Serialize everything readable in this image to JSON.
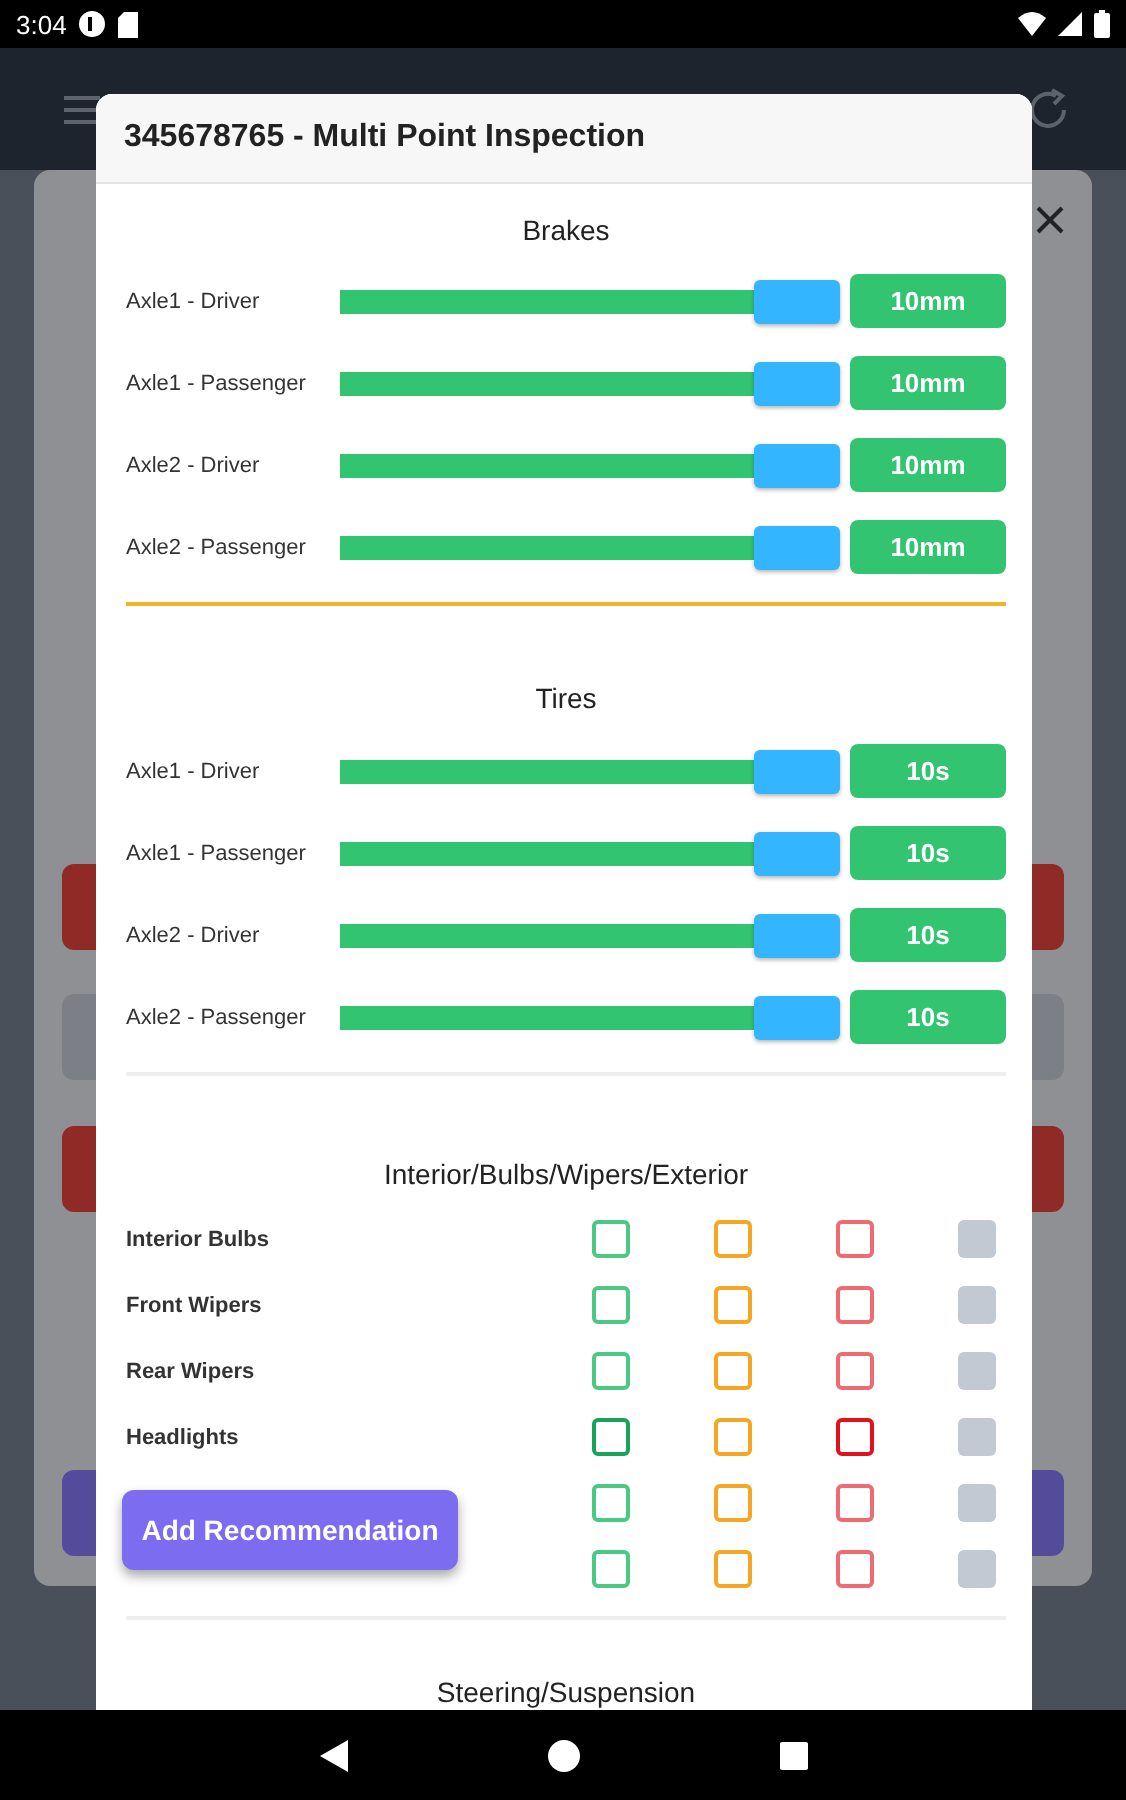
{
  "status_bar": {
    "time": "3:04"
  },
  "dialog": {
    "title": "345678765 - Multi Point Inspection",
    "sections": [
      {
        "kind": "slider",
        "title": "Brakes",
        "divider": {
          "color": "#f0b429"
        },
        "rows": [
          {
            "label": "Axle1 - Driver",
            "level": 1,
            "reading": "10mm"
          },
          {
            "label": "Axle1 - Passenger",
            "level": 1,
            "reading": "10mm"
          },
          {
            "label": "Axle2 - Driver",
            "level": 1,
            "reading": "10mm"
          },
          {
            "label": "Axle2 - Passenger",
            "level": 1,
            "reading": "10mm"
          }
        ]
      },
      {
        "kind": "slider",
        "title": "Tires",
        "divider": {
          "color": "#eeeeee"
        },
        "rows": [
          {
            "label": "Axle1 - Driver",
            "level": 1,
            "reading": "10s"
          },
          {
            "label": "Axle1 - Passenger",
            "level": 1,
            "reading": "10s"
          },
          {
            "label": "Axle2 - Driver",
            "level": 1,
            "reading": "10s"
          },
          {
            "label": "Axle2 - Passenger",
            "level": 1,
            "reading": "10s"
          }
        ]
      },
      {
        "kind": "checks",
        "title": "Interior/Bulbs/Wipers/Exterior",
        "divider": {
          "color": "#eeeeee"
        },
        "rows": [
          {
            "label": "Interior Bulbs",
            "boxes": [
              {
                "kind": "outline",
                "color": "#4cc885",
                "checked": false
              },
              {
                "kind": "outline",
                "color": "#f5a623",
                "checked": false
              },
              {
                "kind": "outline",
                "color": "#ef6b73",
                "checked": false
              },
              {
                "kind": "solid",
                "color": "#c3c9d3",
                "checked": false
              }
            ]
          },
          {
            "label": "Front Wipers",
            "boxes": [
              {
                "kind": "outline",
                "color": "#4cc885",
                "checked": false
              },
              {
                "kind": "outline",
                "color": "#f5a623",
                "checked": false
              },
              {
                "kind": "outline",
                "color": "#ef6b73",
                "checked": false
              },
              {
                "kind": "solid",
                "color": "#c3c9d3",
                "checked": false
              }
            ]
          },
          {
            "label": "Rear Wipers",
            "boxes": [
              {
                "kind": "outline",
                "color": "#4cc885",
                "checked": false
              },
              {
                "kind": "outline",
                "color": "#f5a623",
                "checked": false
              },
              {
                "kind": "outline",
                "color": "#ef6b73",
                "checked": false
              },
              {
                "kind": "solid",
                "color": "#c3c9d3",
                "checked": false
              }
            ]
          },
          {
            "label": "Headlights",
            "boxes": [
              {
                "kind": "outline",
                "color": "#16a35a",
                "checked": false
              },
              {
                "kind": "outline",
                "color": "#f5a623",
                "checked": false
              },
              {
                "kind": "outline",
                "color": "#e3101e",
                "checked": false
              },
              {
                "kind": "solid",
                "color": "#c3c9d3",
                "checked": false
              }
            ]
          },
          {
            "boxes": [
              {
                "kind": "outline",
                "color": "#4cc885",
                "checked": false
              },
              {
                "kind": "outline",
                "color": "#f5a623",
                "checked": false
              },
              {
                "kind": "outline",
                "color": "#ef6b73",
                "checked": false
              },
              {
                "kind": "solid",
                "color": "#c3c9d3",
                "checked": false
              }
            ]
          },
          {
            "boxes": [
              {
                "kind": "outline",
                "color": "#4cc885",
                "checked": false
              },
              {
                "kind": "outline",
                "color": "#f5a623",
                "checked": false
              },
              {
                "kind": "outline",
                "color": "#ef6b73",
                "checked": false
              },
              {
                "kind": "solid",
                "color": "#c3c9d3",
                "checked": false
              }
            ]
          }
        ]
      },
      {
        "kind": "heading",
        "title": "Steering/Suspension"
      }
    ],
    "floating_button": "Add Recommendation"
  }
}
